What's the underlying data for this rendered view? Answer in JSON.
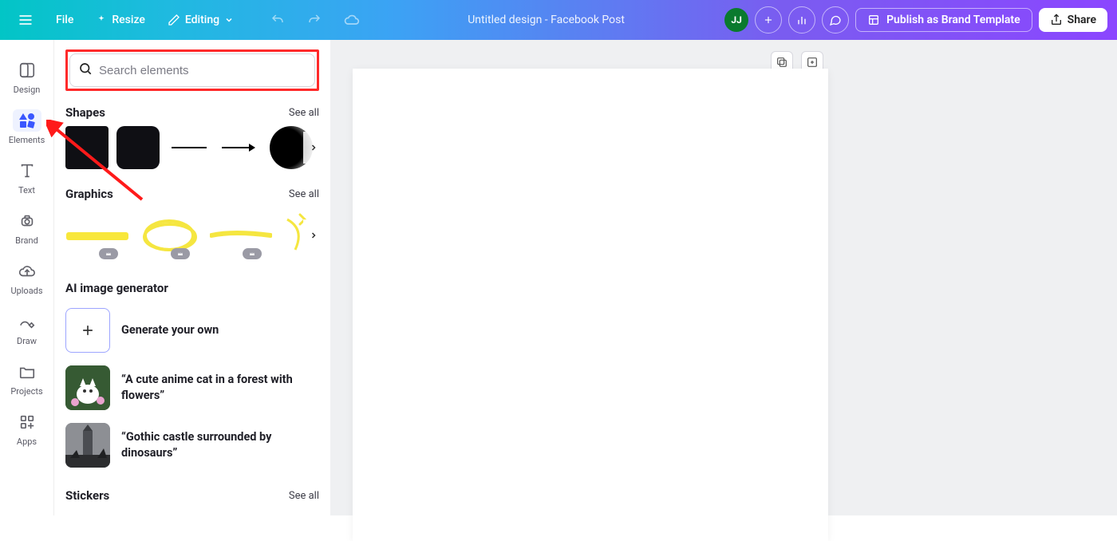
{
  "topbar": {
    "file": "File",
    "resize": "Resize",
    "editing": "Editing",
    "title": "Untitled design - Facebook Post",
    "avatar": "JJ",
    "publish": "Publish as Brand Template",
    "share": "Share"
  },
  "rail": {
    "design": "Design",
    "elements": "Elements",
    "text": "Text",
    "brand": "Brand",
    "uploads": "Uploads",
    "draw": "Draw",
    "projects": "Projects",
    "apps": "Apps"
  },
  "panel": {
    "search_placeholder": "Search elements",
    "shapes": {
      "title": "Shapes",
      "see_all": "See all"
    },
    "graphics": {
      "title": "Graphics",
      "see_all": "See all"
    },
    "ai": {
      "title": "AI image generator",
      "generate": "Generate your own",
      "prompt1": "“A cute anime cat in a forest with flowers”",
      "prompt2": "“Gothic castle surrounded by dinosaurs”"
    },
    "stickers": {
      "title": "Stickers",
      "see_all": "See all"
    }
  }
}
